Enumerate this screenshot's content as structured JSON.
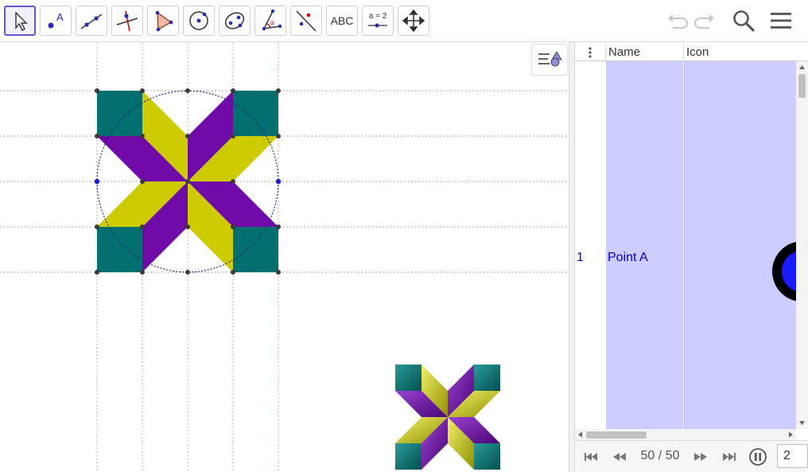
{
  "toolbar": {
    "tools": [
      {
        "name": "move-tool",
        "icon": "cursor-arrow-icon"
      },
      {
        "name": "point-tool",
        "icon": "point-icon",
        "label": "A"
      },
      {
        "name": "line-tool",
        "icon": "line-icon"
      },
      {
        "name": "perpendicular-line-tool",
        "icon": "perpendicular-icon"
      },
      {
        "name": "polygon-tool",
        "icon": "polygon-icon"
      },
      {
        "name": "circle-center-point-tool",
        "icon": "circle-icon"
      },
      {
        "name": "ellipse-tool",
        "icon": "ellipse-icon"
      },
      {
        "name": "angle-tool",
        "icon": "angle-icon",
        "label": "α"
      },
      {
        "name": "reflect-tool",
        "icon": "reflect-icon"
      },
      {
        "name": "text-tool",
        "icon": "text-icon",
        "label": "ABC"
      },
      {
        "name": "slider-tool",
        "icon": "slider-icon",
        "label": "a = 2"
      },
      {
        "name": "move-graphics-tool",
        "icon": "move-arrows-icon"
      }
    ],
    "right": [
      "undo-icon",
      "redo-icon",
      "search-icon",
      "hamburger-menu-icon"
    ]
  },
  "colors": {
    "teal": "#036f6f",
    "yellow": "#cccc00",
    "purple": "#6f0aa6",
    "accent": "#6557d2",
    "table_highlight": "#ccccff",
    "row_text": "#0000cc"
  },
  "protocol": {
    "headers": {
      "name": "Name",
      "icon": "Icon"
    },
    "rows": [
      {
        "number": "1",
        "name": "Point A"
      }
    ]
  },
  "navigation": {
    "step_counter": "50 / 50",
    "speed_value": "2"
  }
}
